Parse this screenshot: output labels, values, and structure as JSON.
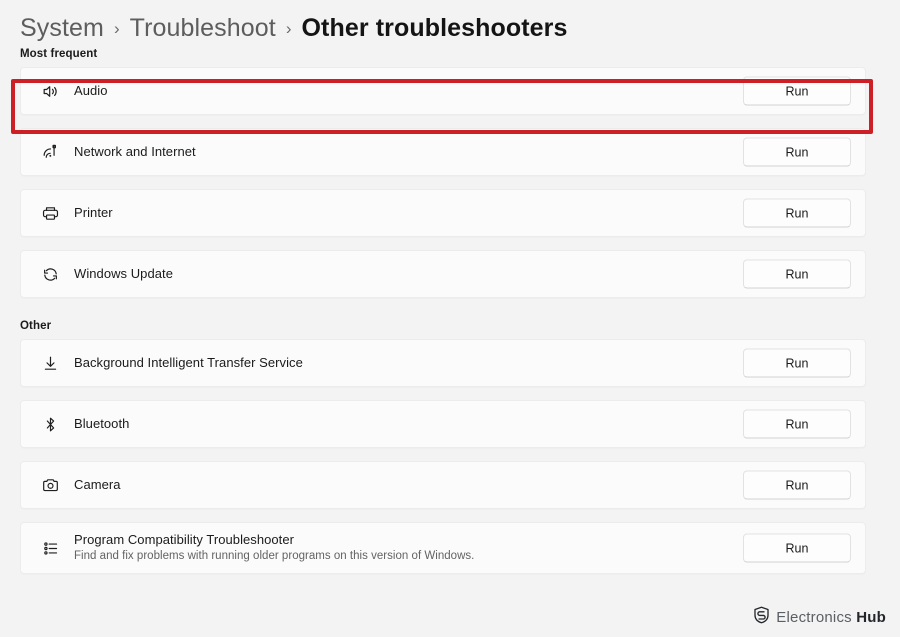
{
  "breadcrumb": {
    "separator": "›",
    "items": [
      {
        "label": "System",
        "current": false
      },
      {
        "label": "Troubleshoot",
        "current": false
      },
      {
        "label": "Other troubleshooters",
        "current": true
      }
    ]
  },
  "sections": [
    {
      "label": "Most frequent",
      "rows": [
        {
          "title": "Audio",
          "subtitle": "",
          "icon": "speaker-icon",
          "action": "Run",
          "highlighted": true
        },
        {
          "title": "Network and Internet",
          "subtitle": "",
          "icon": "wifi-icon",
          "action": "Run",
          "highlighted": false
        },
        {
          "title": "Printer",
          "subtitle": "",
          "icon": "printer-icon",
          "action": "Run",
          "highlighted": false
        },
        {
          "title": "Windows Update",
          "subtitle": "",
          "icon": "refresh-icon",
          "action": "Run",
          "highlighted": false
        }
      ]
    },
    {
      "label": "Other",
      "rows": [
        {
          "title": "Background Intelligent Transfer Service",
          "subtitle": "",
          "icon": "download-icon",
          "action": "Run",
          "highlighted": false
        },
        {
          "title": "Bluetooth",
          "subtitle": "",
          "icon": "bluetooth-icon",
          "action": "Run",
          "highlighted": false
        },
        {
          "title": "Camera",
          "subtitle": "",
          "icon": "camera-icon",
          "action": "Run",
          "highlighted": false
        },
        {
          "title": "Program Compatibility Troubleshooter",
          "subtitle": "Find and fix problems with running older programs on this version of Windows.",
          "icon": "list-settings-icon",
          "action": "Run",
          "highlighted": false
        }
      ]
    }
  ],
  "annotation": {
    "color": "#cc2026",
    "target": "Audio"
  },
  "watermark": {
    "logo": "shield-icon",
    "text_light": "Electronics",
    "text_bold": "Hub"
  },
  "colors": {
    "page_background": "#f3f3f3",
    "card_background": "#fbfbfb",
    "highlight_red": "#cc2026",
    "text_primary": "#1b1b1b",
    "text_secondary": "#636363"
  }
}
